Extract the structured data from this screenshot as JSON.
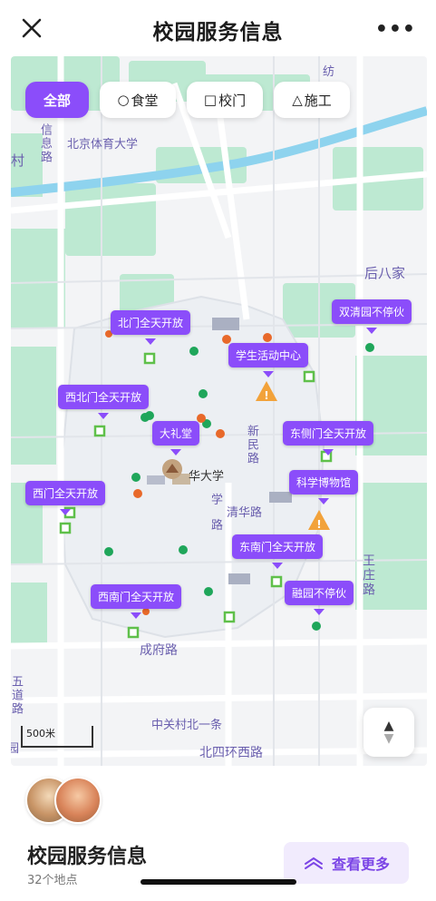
{
  "header": {
    "title": "校园服务信息",
    "close_icon": "close-icon",
    "more_label": "•••"
  },
  "filters": [
    {
      "label": "全部",
      "glyph": "",
      "active": true
    },
    {
      "label": "食堂",
      "glyph": "○",
      "active": false
    },
    {
      "label": "校门",
      "glyph": "□",
      "active": false
    },
    {
      "label": "施工",
      "glyph": "△",
      "active": false
    }
  ],
  "map_labels": {
    "beijing_sport_univ": "北京体育大学",
    "xinxi_road": "信息路",
    "cun": "村",
    "fang": "纺",
    "houbajia": "后八家",
    "xinmin_road": "新民路",
    "tsinghua_univ": "华大学",
    "xue_road": "学",
    "qinghua_road": "清华路",
    "lu": "路",
    "wangzhuang_road": "王庄路",
    "chengfu_road": "成府路",
    "wudao": "五道路",
    "zhongguancun": "中关村北一条",
    "beisihuan": "北四环西路",
    "dong": "园"
  },
  "map_tags": {
    "north_gate": "北门全天开放",
    "student_center": "学生活动中心",
    "shuangqing": "双清园不停伙",
    "northwest_gate": "西北门全天开放",
    "auditorium": "大礼堂",
    "east_gate": "东侧门全天开放",
    "museum": "科学博物馆",
    "west_gate": "西门全天开放",
    "southeast_gate": "东南门全天开放",
    "rongyuan": "融园不停伙",
    "southwest_gate": "西南门全天开放"
  },
  "scale": {
    "label": "500米"
  },
  "compass": {
    "up": "▲",
    "down": "▼"
  },
  "colors": {
    "accent": "#8b4dfa",
    "canteen_green": "#1fa65a",
    "gate_green": "#5fc04a",
    "marker_orange": "#e8692a",
    "warning_orange": "#f2a23a",
    "park_green": "#b8e8cf"
  },
  "bottom": {
    "name": "校园服务信息",
    "count": "32个地点",
    "see_more": "查看更多"
  }
}
